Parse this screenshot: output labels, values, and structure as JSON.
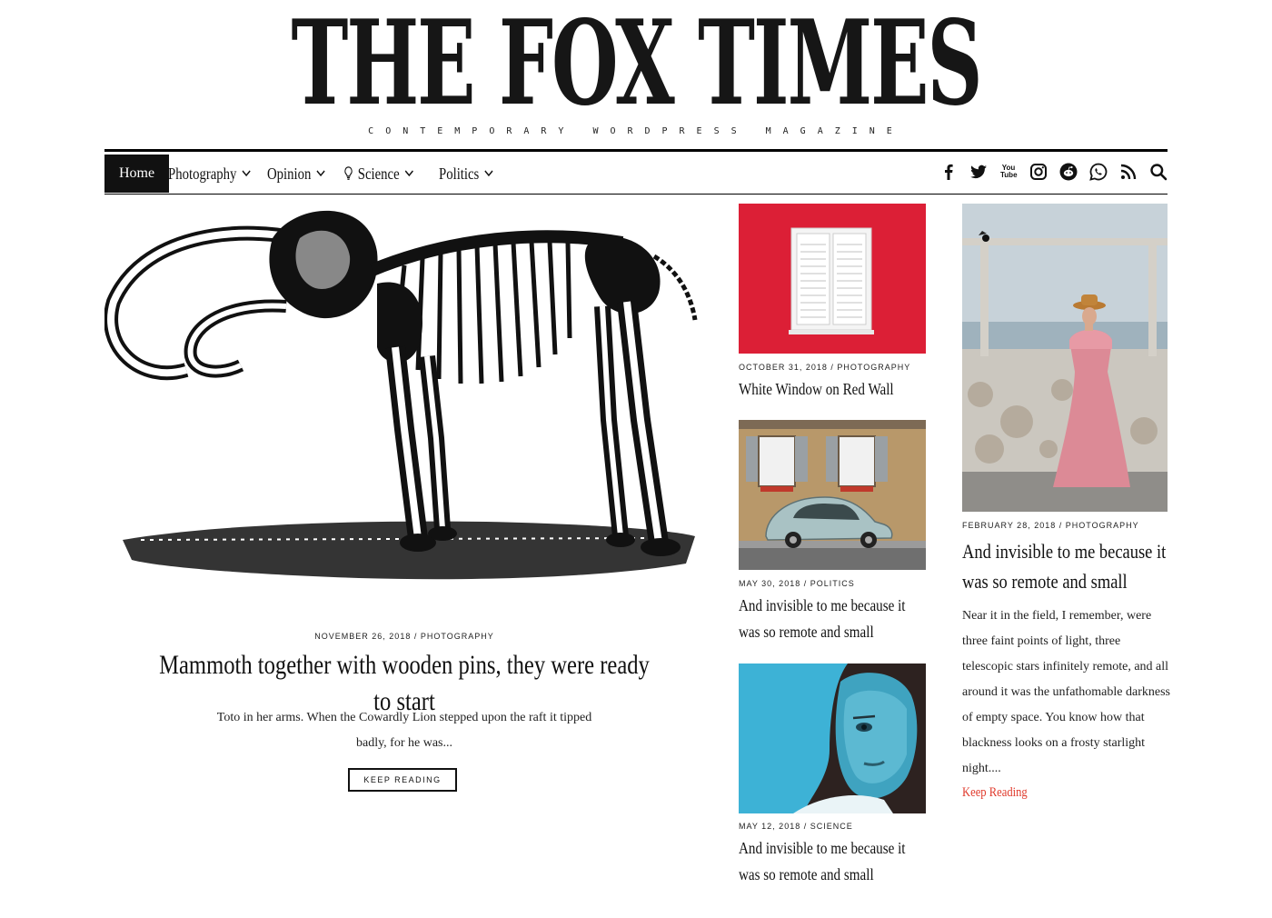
{
  "site": {
    "title": "THE FOX TIMES",
    "tagline": "CONTEMPORARY WORDPRESS MAGAZINE"
  },
  "nav": {
    "items": [
      {
        "label": "Home"
      },
      {
        "label": "Photography"
      },
      {
        "label": "Opinion"
      },
      {
        "label": "Science"
      },
      {
        "label": "Politics"
      }
    ],
    "social": [
      "facebook-icon",
      "twitter-icon",
      "youtube-icon",
      "instagram-icon",
      "reddit-icon",
      "whatsapp-icon",
      "rss-icon",
      "search-icon"
    ],
    "youtube_text": "You Tube"
  },
  "hero": {
    "date": "NOVEMBER 26, 2018",
    "category": "PHOTOGRAPHY",
    "title": "Mammoth together with wooden pins, they were ready to start",
    "excerpt": "Toto in her arms. When the Cowardly Lion stepped upon the raft it tipped badly, for he was...",
    "button": "KEEP READING"
  },
  "cards": [
    {
      "date": "OCTOBER 31, 2018",
      "category": "PHOTOGRAPHY",
      "title": "White Window on Red Wall"
    },
    {
      "date": "MAY 30, 2018",
      "category": "POLITICS",
      "title": "And invisible to me because it was so remote and small"
    },
    {
      "date": "MAY 12, 2018",
      "category": "SCIENCE",
      "title": "And invisible to me because it was so remote and small"
    }
  ],
  "right_post": {
    "date": "FEBRUARY 28, 2018",
    "category": "PHOTOGRAPHY",
    "title": "And invisible to me because it was so remote and small",
    "excerpt": "Near it in the field, I remember, were three faint points of light, three telescopic stars infinitely remote, and all around it was the unfathomable darkness of empty space. You know how that blackness looks on a frosty starlight night....",
    "more": "Keep Reading"
  },
  "colors": {
    "accent": "#e03a2c",
    "red_wall": "#dc1f36",
    "blue_bg": "#3db2d6"
  }
}
